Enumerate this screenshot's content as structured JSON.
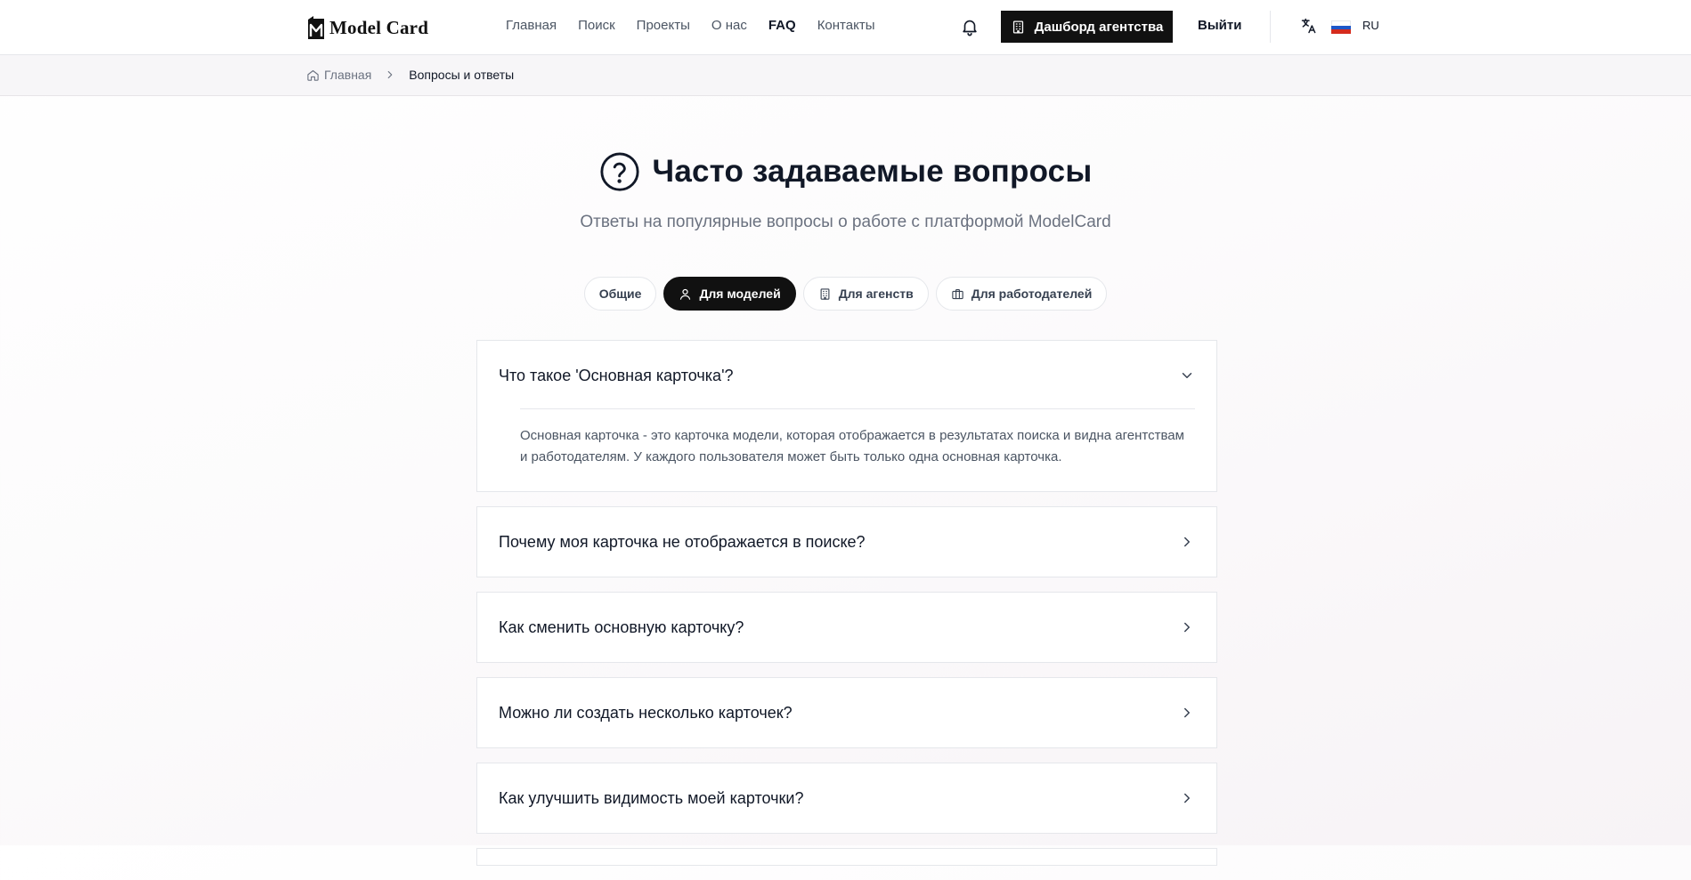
{
  "header": {
    "logo_text": "Model Card",
    "nav": [
      {
        "label": "Главная",
        "active": false
      },
      {
        "label": "Поиск",
        "active": false
      },
      {
        "label": "Проекты",
        "active": false
      },
      {
        "label": "О нас",
        "active": false
      },
      {
        "label": "FAQ",
        "active": true
      },
      {
        "label": "Контакты",
        "active": false
      }
    ],
    "dashboard_label": "Дашборд агентства",
    "logout_label": "Выйти",
    "lang_code": "RU",
    "icons": [
      "bell-icon",
      "building-icon",
      "translate-icon",
      "flag-ru-icon"
    ]
  },
  "breadcrumb": {
    "home": "Главная",
    "current": "Вопросы и ответы"
  },
  "hero": {
    "title": "Часто задаваемые вопросы",
    "subtitle": "Ответы на популярные вопросы о работе с платформой ModelCard"
  },
  "tabs": [
    {
      "label": "Общие",
      "icon": "",
      "active": false
    },
    {
      "label": "Для моделей",
      "icon": "user-icon",
      "active": true
    },
    {
      "label": "Для агенств",
      "icon": "building-icon",
      "active": false
    },
    {
      "label": "Для работодателей",
      "icon": "briefcase-icon",
      "active": false
    }
  ],
  "faq": [
    {
      "question": "Что такое 'Основная карточка'?",
      "answer": "Основная карточка - это карточка модели, которая отображается в результатах поиска и видна агентствам и работодателям. У каждого пользователя может быть только одна основная карточка.",
      "expanded": true
    },
    {
      "question": "Почему моя карточка не отображается в поиске?",
      "expanded": false
    },
    {
      "question": "Как сменить основную карточку?",
      "expanded": false
    },
    {
      "question": "Можно ли создать несколько карточек?",
      "expanded": false
    },
    {
      "question": "Как улучшить видимость моей карточки?",
      "expanded": false
    }
  ],
  "colors": {
    "accent": "#111111",
    "text": "#111827",
    "muted": "#6b7280",
    "border": "#e5e7eb",
    "flag_white": "#ffffff",
    "flag_blue": "#1c57c9",
    "flag_red": "#d52b1e"
  }
}
